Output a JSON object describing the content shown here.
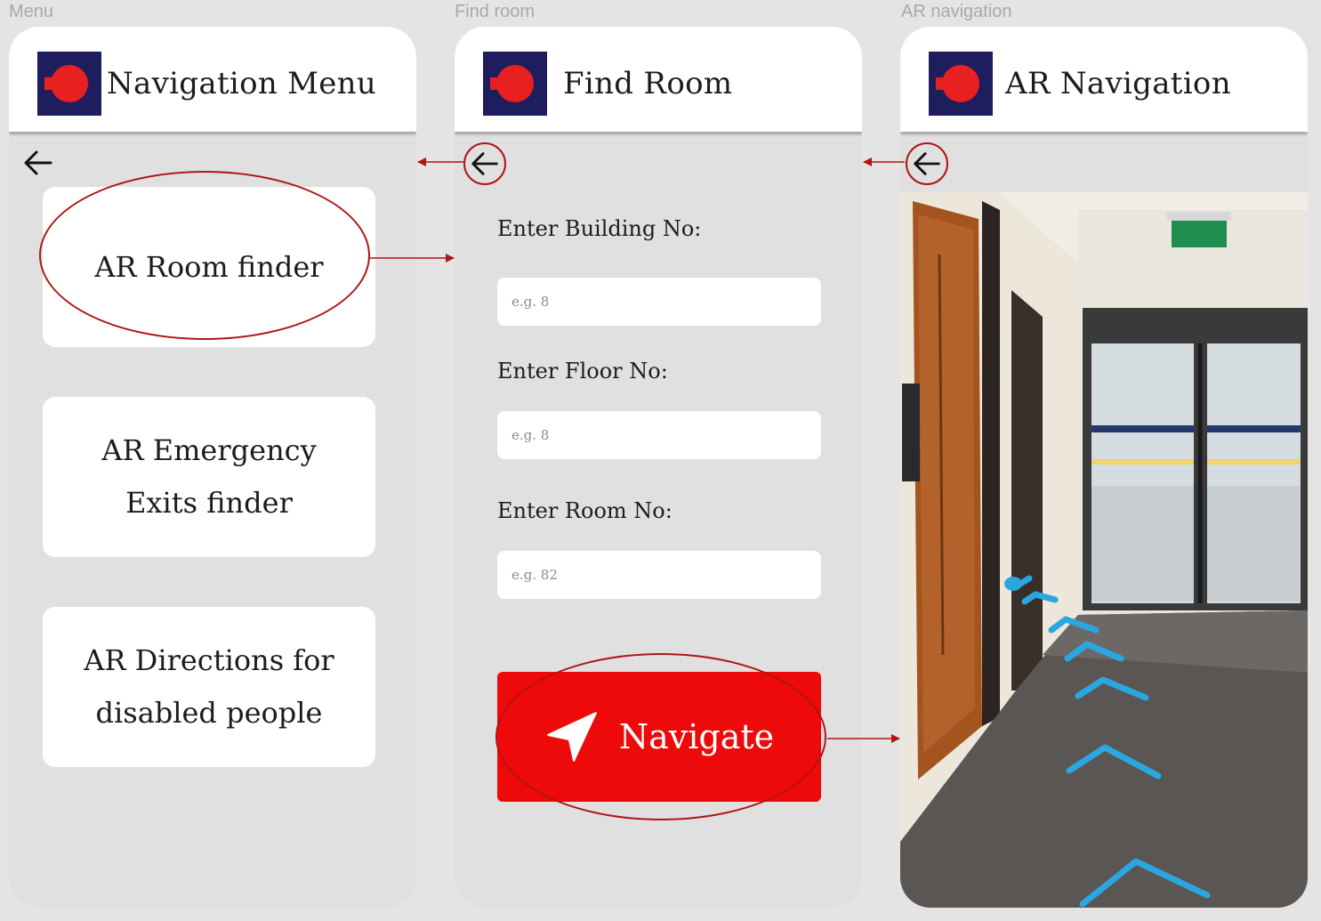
{
  "frames": {
    "menu": "Menu",
    "find_room": "Find room",
    "ar_navigation": "AR navigation"
  },
  "menu_screen": {
    "title": "Navigation Menu",
    "items": [
      {
        "line1": "AR Room finder",
        "line2": ""
      },
      {
        "line1": "AR Emergency",
        "line2": "Exits finder"
      },
      {
        "line1": "AR Directions for",
        "line2": "disabled people"
      }
    ]
  },
  "find_room_screen": {
    "title": "Find Room",
    "building_label": "Enter Building No:",
    "building_placeholder": "e.g. 8",
    "floor_label": "Enter Floor No:",
    "floor_placeholder": "e.g. 8",
    "room_label": "Enter Room No:",
    "room_placeholder": "e.g. 82",
    "navigate_label": "Navigate"
  },
  "ar_screen": {
    "title": "AR Navigation"
  },
  "icons": {
    "logo": "brand-logo-icon",
    "back": "arrow-left-icon",
    "navigate": "navigation-arrow-icon"
  },
  "colors": {
    "brand_navy": "#1e1d5e",
    "brand_red": "#e8201f",
    "button_red": "#ee0a0a",
    "annotation_red": "#b01515",
    "ar_arrow_blue": "#2aa7e0"
  }
}
